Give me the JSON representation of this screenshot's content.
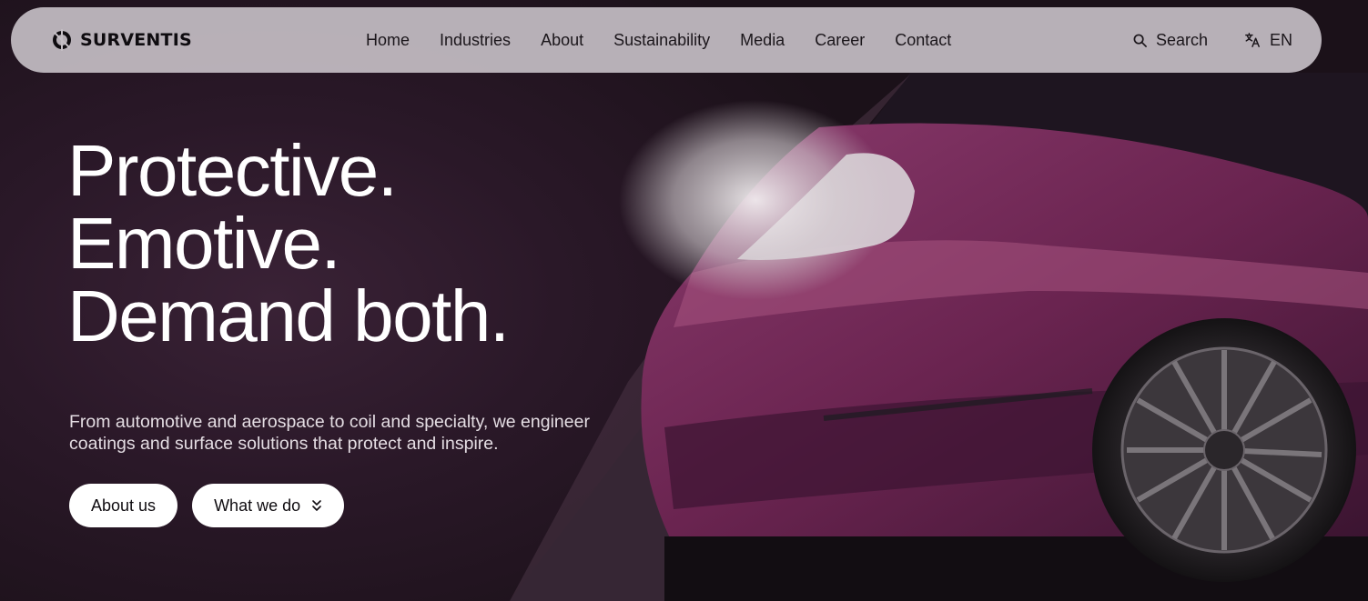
{
  "brand": {
    "name": "SURVENTIS",
    "logo_icon": "ring-logo-icon"
  },
  "nav": {
    "items": [
      {
        "label": "Home"
      },
      {
        "label": "Industries"
      },
      {
        "label": "About"
      },
      {
        "label": "Sustainability"
      },
      {
        "label": "Media"
      },
      {
        "label": "Career"
      },
      {
        "label": "Contact"
      }
    ],
    "search": {
      "label": "Search",
      "icon": "search-icon"
    },
    "language": {
      "label": "EN",
      "icon": "translate-icon"
    }
  },
  "hero": {
    "headline": [
      "Protective.",
      "Emotive.",
      "Demand both."
    ],
    "subcopy": "From automotive and aerospace to coil and specialty, we engineer coatings and surface solutions that protect and inspire.",
    "buttons": {
      "primary": "About us",
      "secondary": "What we do",
      "secondary_icon": "chevrons-down-icon"
    }
  },
  "colors": {
    "navbar_bg": "#c4bec4",
    "hero_bg": "#2a1828",
    "car_paint": "#7a2a5c",
    "button_bg": "#ffffff"
  }
}
